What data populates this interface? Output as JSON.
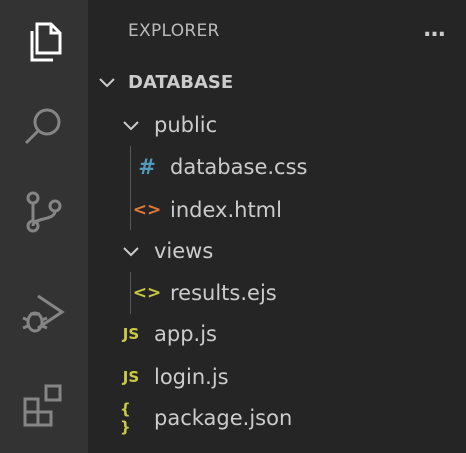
{
  "explorer": {
    "header": "EXPLORER",
    "more_label": "…",
    "root_label": "DATABASE",
    "tree": [
      {
        "label": "public",
        "kind": "folder"
      },
      {
        "label": "database.css",
        "kind": "file",
        "icon": "hash-icon",
        "icon_text": "#",
        "icon_color": "#519aba"
      },
      {
        "label": "index.html",
        "kind": "file",
        "icon": "html-brackets-icon",
        "icon_text": "<>",
        "icon_color": "#e37933"
      },
      {
        "label": "views",
        "kind": "folder"
      },
      {
        "label": "results.ejs",
        "kind": "file",
        "icon": "ejs-brackets-icon",
        "icon_text": "<>",
        "icon_color": "#cbcb41"
      },
      {
        "label": "app.js",
        "kind": "file",
        "icon": "js-icon",
        "icon_text": "JS",
        "icon_color": "#cbcb41"
      },
      {
        "label": "login.js",
        "kind": "file",
        "icon": "js-icon",
        "icon_text": "JS",
        "icon_color": "#cbcb41"
      },
      {
        "label": "package.json",
        "kind": "file",
        "icon": "json-braces-icon",
        "icon_text": "{ }",
        "icon_color": "#cbcb41"
      }
    ]
  },
  "activity_bar": [
    {
      "name": "explorer-icon",
      "active": true
    },
    {
      "name": "search-icon",
      "active": false
    },
    {
      "name": "source-control-icon",
      "active": false
    },
    {
      "name": "run-debug-icon",
      "active": false
    },
    {
      "name": "extensions-icon",
      "active": false
    }
  ],
  "colors": {
    "activity_bg": "#333333",
    "sidebar_bg": "#252526",
    "icon_active": "#ffffff",
    "icon_inactive": "#858585"
  }
}
